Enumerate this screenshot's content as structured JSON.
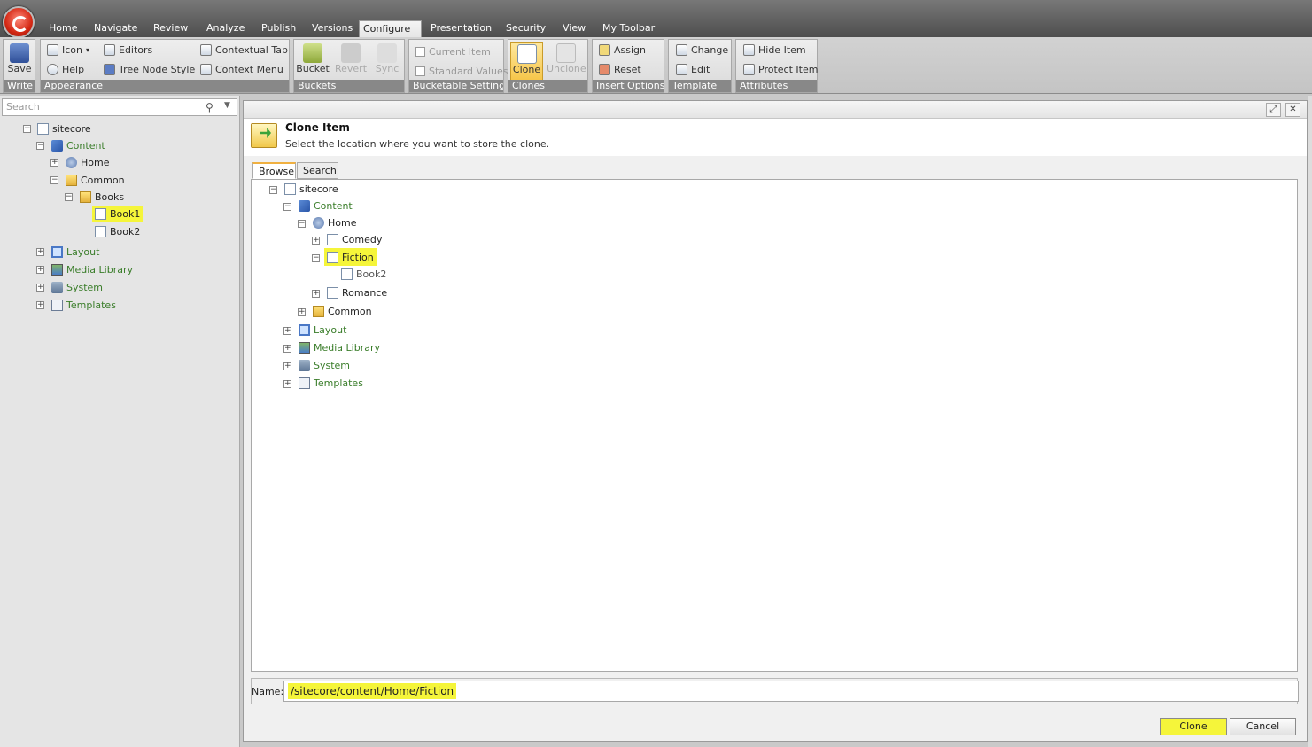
{
  "ribbon_tabs": [
    "Home",
    "Navigate",
    "Review",
    "Analyze",
    "Publish",
    "Versions",
    "Configure",
    "Presentation",
    "Security",
    "View",
    "My Toolbar"
  ],
  "ribbon": {
    "write": {
      "label": "Write",
      "save": "Save"
    },
    "appearance": {
      "label": "Appearance",
      "icon": "Icon",
      "help": "Help",
      "editors": "Editors",
      "tree_node_style": "Tree Node Style",
      "contextual_tab": "Contextual Tab",
      "context_menu": "Context Menu"
    },
    "buckets": {
      "label": "Buckets",
      "bucket": "Bucket",
      "revert": "Revert",
      "sync": "Sync"
    },
    "bucketable": {
      "label": "Bucketable Settings",
      "current_item": "Current Item",
      "standard_values": "Standard Values"
    },
    "clones": {
      "label": "Clones",
      "clone": "Clone",
      "unclone": "Unclone"
    },
    "insert_options": {
      "label": "Insert Options",
      "assign": "Assign",
      "reset": "Reset"
    },
    "template": {
      "label": "Template",
      "change": "Change",
      "edit": "Edit"
    },
    "attributes": {
      "label": "Attributes",
      "hide_item": "Hide Item",
      "protect_item": "Protect Item"
    }
  },
  "left": {
    "search_placeholder": "Search",
    "tree": {
      "sitecore": "sitecore",
      "content": "Content",
      "home": "Home",
      "common": "Common",
      "books": "Books",
      "book1": "Book1",
      "book2": "Book2",
      "layout": "Layout",
      "media": "Media Library",
      "system": "System",
      "templates": "Templates"
    }
  },
  "dialog": {
    "title": "Clone Item",
    "subtitle": "Select the location where you want to store the clone.",
    "tabs": {
      "browse": "Browse",
      "search": "Search"
    },
    "tree": {
      "sitecore": "sitecore",
      "content": "Content",
      "home": "Home",
      "comedy": "Comedy",
      "fiction": "Fiction",
      "book2": "Book2",
      "romance": "Romance",
      "common": "Common",
      "layout": "Layout",
      "media": "Media Library",
      "system": "System",
      "templates": "Templates"
    },
    "name_label": "Name:",
    "name_value": "/sitecore/content/Home/Fiction",
    "clone_button": "Clone",
    "cancel_button": "Cancel"
  }
}
